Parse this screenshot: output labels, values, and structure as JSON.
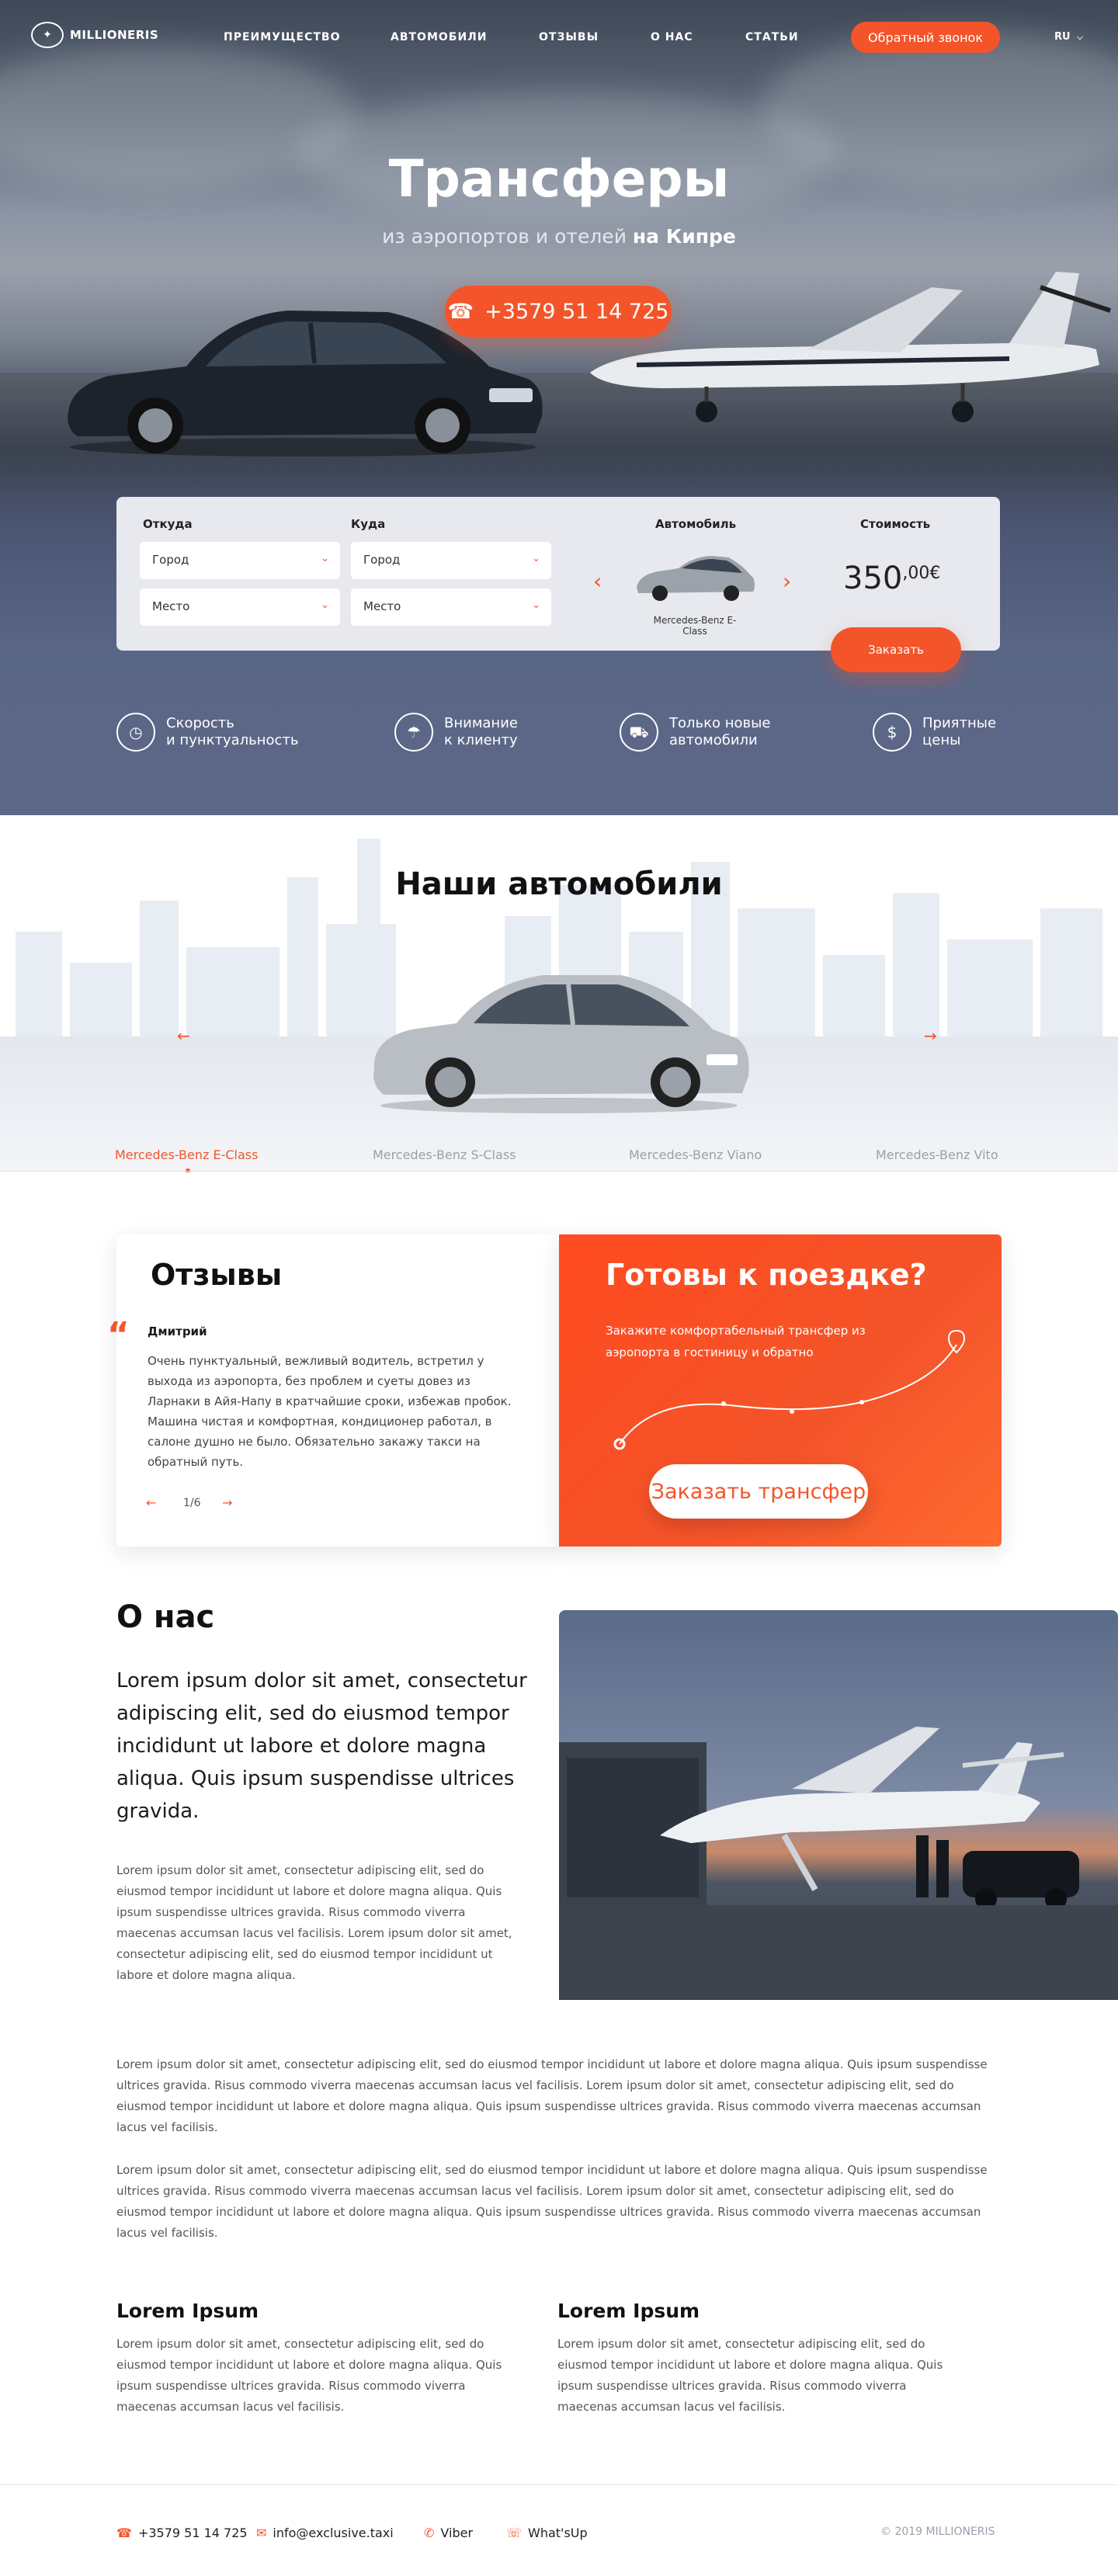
{
  "header": {
    "logo": "MILLIONERIS",
    "menu": [
      "ПРЕИМУЩЕСТВО",
      "АВТОМОБИЛИ",
      "ОТЗЫВЫ",
      "О НАС",
      "СТАТЬИ"
    ],
    "callback_label": "Обратный звонок",
    "lang": "RU"
  },
  "hero": {
    "title": "Трансферы",
    "subtitle_plain": "из аэропортов и отелей",
    "subtitle_bold": "на Кипре",
    "phone": "+3579 51 14 725"
  },
  "booking": {
    "from_label": "Откуда",
    "to_label": "Куда",
    "car_label": "Автомобиль",
    "price_label": "Стоимость",
    "city_placeholder": "Город",
    "place_placeholder": "Место",
    "car_name": "Mercedes-Benz E-Class",
    "price_main": "350",
    "price_sup": ",00€",
    "order_label": "Заказать"
  },
  "features": [
    {
      "line1": "Скорость",
      "line2": "и пунктуальность"
    },
    {
      "line1": "Внимание",
      "line2": "к клиенту"
    },
    {
      "line1": "Только новые",
      "line2": "автомобили"
    },
    {
      "line1": "Приятные",
      "line2": "цены"
    }
  ],
  "cars": {
    "title": "Наши автомобили",
    "tabs": [
      "Mercedes-Benz E-Class",
      "Mercedes-Benz S-Class",
      "Mercedes-Benz Viano",
      "Mercedes-Benz Vito"
    ]
  },
  "reviews": {
    "title": "Отзывы",
    "author": "Дмитрий",
    "text": "Очень пунктуальный, вежливый водитель, встретил у выхода из аэропорта, без проблем и суеты довез из Ларнаки в Айя-Напу в кратчайшие сроки, избежав пробок. Машина чистая и комфортная, кондиционер работал, в салоне душно не было. Обязательно закажу такси на обратный путь.",
    "counter": "1/6"
  },
  "ready": {
    "title": "Готовы к поездке?",
    "text": "Закажите комфортабельный трансфер из аэропорта в гостиницу и обратно",
    "button": "Заказать трансфер"
  },
  "about": {
    "title": "О нас",
    "lead": "Lorem ipsum dolor sit amet, consectetur adipiscing elit, sed do eiusmod tempor incididunt ut labore et dolore magna aliqua. Quis ipsum suspendisse ultrices gravida.",
    "p1": "Lorem ipsum dolor sit amet, consectetur adipiscing elit, sed do eiusmod tempor incididunt ut labore et dolore magna aliqua. Quis ipsum suspendisse ultrices gravida. Risus commodo viverra maecenas accumsan lacus vel facilisis. Lorem ipsum dolor sit amet, consectetur adipiscing elit, sed do eiusmod tempor incididunt ut labore et dolore magna aliqua.",
    "p2": "Lorem ipsum dolor sit amet, consectetur adipiscing elit, sed do eiusmod tempor incididunt ut labore et dolore magna aliqua. Quis ipsum suspendisse ultrices gravida. Risus commodo viverra maecenas accumsan lacus vel facilisis.  Lorem ipsum dolor sit amet, consectetur adipiscing elit, sed do eiusmod tempor incididunt ut labore et dolore magna aliqua. Quis ipsum suspendisse ultrices gravida. Risus commodo viverra maecenas accumsan lacus vel facilisis.",
    "p3": "Lorem ipsum dolor sit amet, consectetur adipiscing elit, sed do eiusmod tempor incididunt ut labore et dolore magna aliqua. Quis ipsum suspendisse ultrices gravida. Risus commodo viverra maecenas accumsan lacus vel facilisis.  Lorem ipsum dolor sit amet, consectetur adipiscing elit, sed do eiusmod tempor incididunt ut labore et dolore magna aliqua. Quis ipsum suspendisse ultrices gravida. Risus commodo viverra maecenas accumsan lacus vel facilisis.",
    "col1_title": "Lorem Ipsum",
    "col1_text": "Lorem ipsum dolor sit amet, consectetur adipiscing elit, sed do eiusmod tempor incididunt ut labore et dolore magna aliqua. Quis ipsum suspendisse ultrices gravida. Risus commodo viverra maecenas accumsan lacus vel facilisis.",
    "col2_title": "Lorem Ipsum",
    "col2_text": "Lorem ipsum dolor sit amet, consectetur adipiscing elit, sed do eiusmod tempor incididunt ut labore et dolore magna aliqua. Quis ipsum suspendisse ultrices gravida. Risus commodo viverra maecenas accumsan lacus vel facilisis."
  },
  "footer": {
    "phone": "+3579 51 14 725",
    "email": "info@exclusive.taxi",
    "viber": "Viber",
    "whatsapp": "What'sUp",
    "copyright": "© 2019 MILLIONERIS"
  },
  "colors": {
    "accent": "#f4542a",
    "hero_bottom": "#5d6889"
  }
}
